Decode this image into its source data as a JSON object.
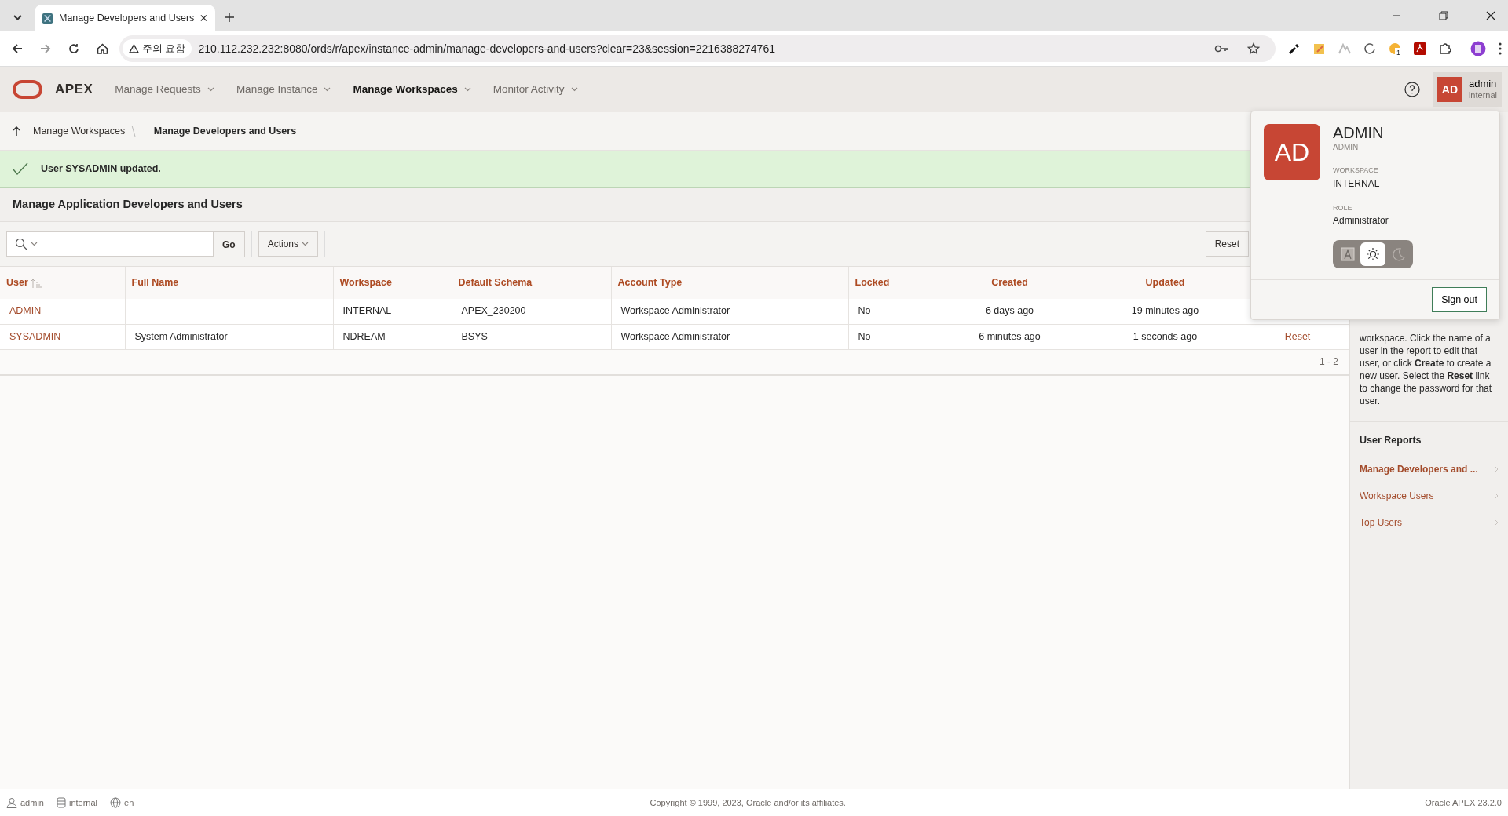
{
  "browser": {
    "tab_title": "Manage Developers and Users",
    "security_label": "주의 요함",
    "url": "210.112.232.232:8080/ords/r/apex/instance-admin/manage-developers-and-users?clear=23&session=2216388274761",
    "extension_badge": "1"
  },
  "header": {
    "logo_text": "APEX",
    "menus": [
      {
        "label": "Manage Requests",
        "selected": false
      },
      {
        "label": "Manage Instance",
        "selected": false
      },
      {
        "label": "Manage Workspaces",
        "selected": true
      },
      {
        "label": "Monitor Activity",
        "selected": false
      }
    ],
    "user": {
      "initials": "AD",
      "name": "admin",
      "workspace": "internal"
    }
  },
  "breadcrumb": [
    {
      "label": "Manage Workspaces",
      "selected": false
    },
    {
      "label": "Manage Developers and Users",
      "selected": true
    }
  ],
  "alert": {
    "message": "User SYSADMIN updated."
  },
  "region": {
    "title": "Manage Application Developers and Users",
    "toolbar": {
      "go_label": "Go",
      "actions_label": "Actions",
      "reset_label": "Reset"
    },
    "table": {
      "columns": [
        {
          "label": "User",
          "sorted": true
        },
        {
          "label": "Full Name",
          "sorted": false
        },
        {
          "label": "Workspace",
          "sorted": false
        },
        {
          "label": "Default Schema",
          "sorted": false
        },
        {
          "label": "Account Type",
          "sorted": false
        },
        {
          "label": "Locked",
          "sorted": false
        },
        {
          "label": "Created",
          "sorted": false
        },
        {
          "label": "Updated",
          "sorted": false
        }
      ],
      "rows": [
        {
          "cells": [
            "ADMIN",
            "",
            "INTERNAL",
            "APEX_230200",
            "Workspace Administrator",
            "No",
            "6 days ago",
            "19 minutes ago"
          ]
        },
        {
          "cells": [
            "SYSADMIN",
            "System Administrator",
            "NDREAM",
            "BSYS",
            "Workspace Administrator",
            "No",
            "6 minutes ago",
            "1 seconds ago"
          ],
          "reset": "Reset"
        }
      ],
      "pagination": "1 - 2"
    }
  },
  "sidebar": {
    "help_text": "workspace. Click the name of a user in the report to edit that user, or click **Create** to create a new user. Select the **Reset** link to change the password for that user.",
    "reports_title": "User Reports",
    "links": [
      {
        "label": "Manage Developers and ...",
        "selected": true
      },
      {
        "label": "Workspace Users",
        "selected": false
      },
      {
        "label": "Top Users",
        "selected": false
      }
    ]
  },
  "user_menu": {
    "initials": "AD",
    "name": "ADMIN",
    "username": "ADMIN",
    "workspace_label": "WORKSPACE",
    "workspace": "INTERNAL",
    "role_label": "ROLE",
    "role": "Administrator",
    "theme_options": [
      {
        "kind": "auto",
        "selected": false
      },
      {
        "kind": "light",
        "selected": true
      },
      {
        "kind": "dark",
        "selected": false
      }
    ],
    "sign_out_label": "Sign out"
  },
  "footer": {
    "user": "admin",
    "workspace": "internal",
    "language": "en",
    "copyright": "Copyright © 1999, 2023, Oracle and/or its affiliates.",
    "version": "Oracle APEX 23.2.0"
  }
}
